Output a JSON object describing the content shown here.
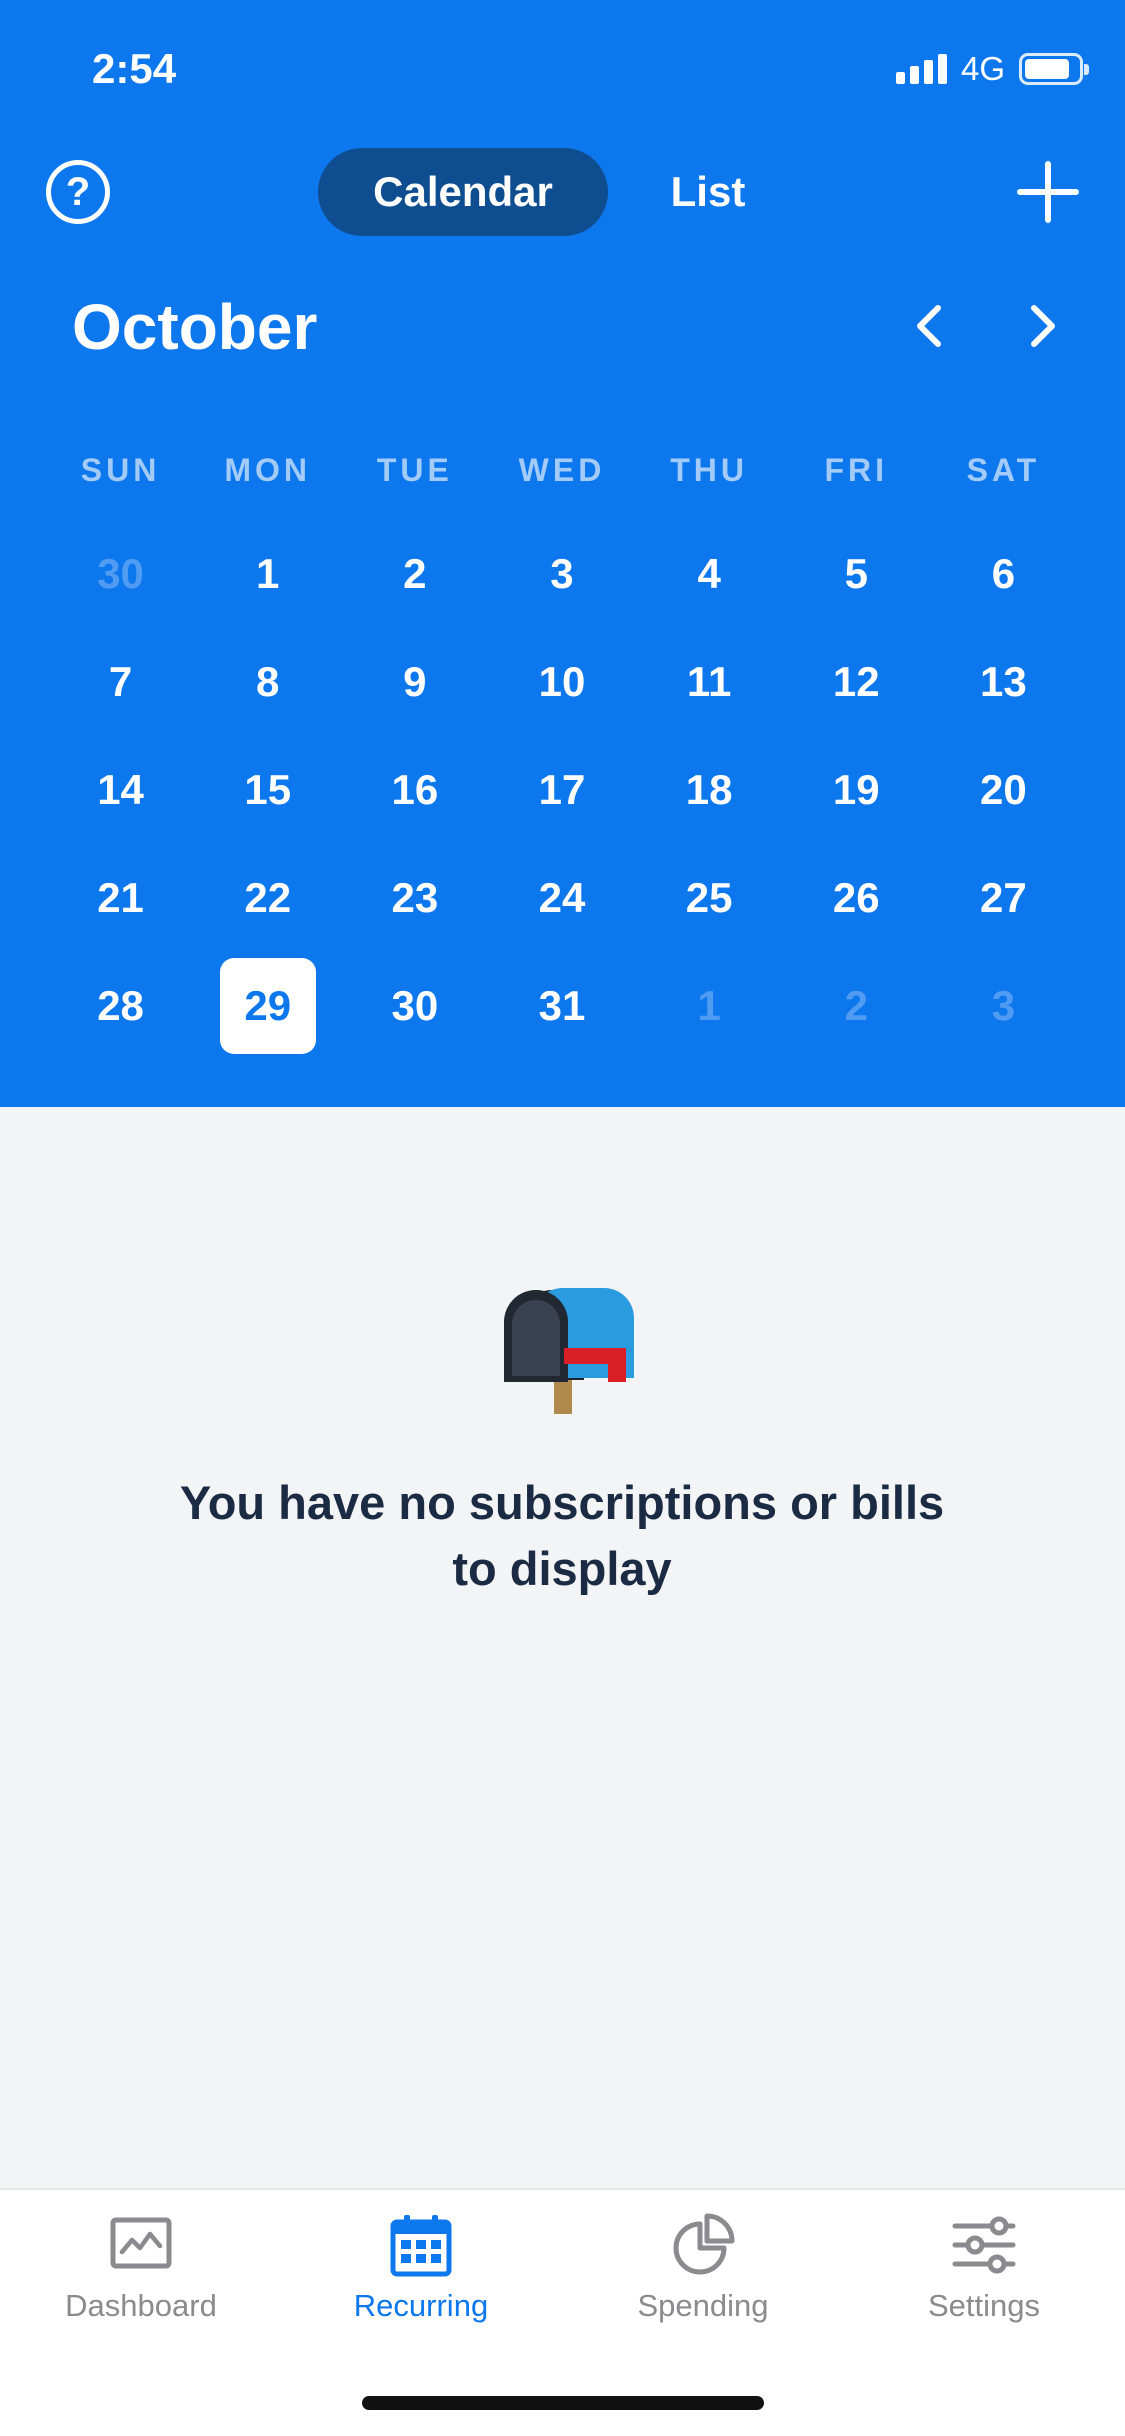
{
  "status_bar": {
    "time": "2:54",
    "network": "4G"
  },
  "header": {
    "help_icon": "question-circle-icon",
    "segments": {
      "calendar": "Calendar",
      "list": "List",
      "active": "Calendar"
    },
    "add_icon": "plus-icon"
  },
  "calendar": {
    "month": "October",
    "prev_icon": "chevron-left-icon",
    "next_icon": "chevron-right-icon",
    "weekdays": [
      "SUN",
      "MON",
      "TUE",
      "WED",
      "THU",
      "FRI",
      "SAT"
    ],
    "days": [
      "30",
      "1",
      "2",
      "3",
      "4",
      "5",
      "6",
      "7",
      "8",
      "9",
      "10",
      "11",
      "12",
      "13",
      "14",
      "15",
      "16",
      "17",
      "18",
      "19",
      "20",
      "21",
      "22",
      "23",
      "24",
      "25",
      "26",
      "27",
      "28",
      "29",
      "30",
      "31",
      "1",
      "2",
      "3"
    ],
    "selected_day": "29"
  },
  "empty_state": {
    "icon": "mailbox-icon",
    "message": "You have no subscriptions or bills to display"
  },
  "tabbar": {
    "items": [
      {
        "label": "Dashboard",
        "icon": "dashboard-chart-icon"
      },
      {
        "label": "Recurring",
        "icon": "calendar-icon"
      },
      {
        "label": "Spending",
        "icon": "pie-chart-icon"
      },
      {
        "label": "Settings",
        "icon": "sliders-icon"
      }
    ],
    "active": "Recurring"
  },
  "colors": {
    "primary": "#0d77ee",
    "segment_active": "#0e4d8f",
    "background": "#f3f4f6",
    "text_dark": "#1b2b43"
  }
}
